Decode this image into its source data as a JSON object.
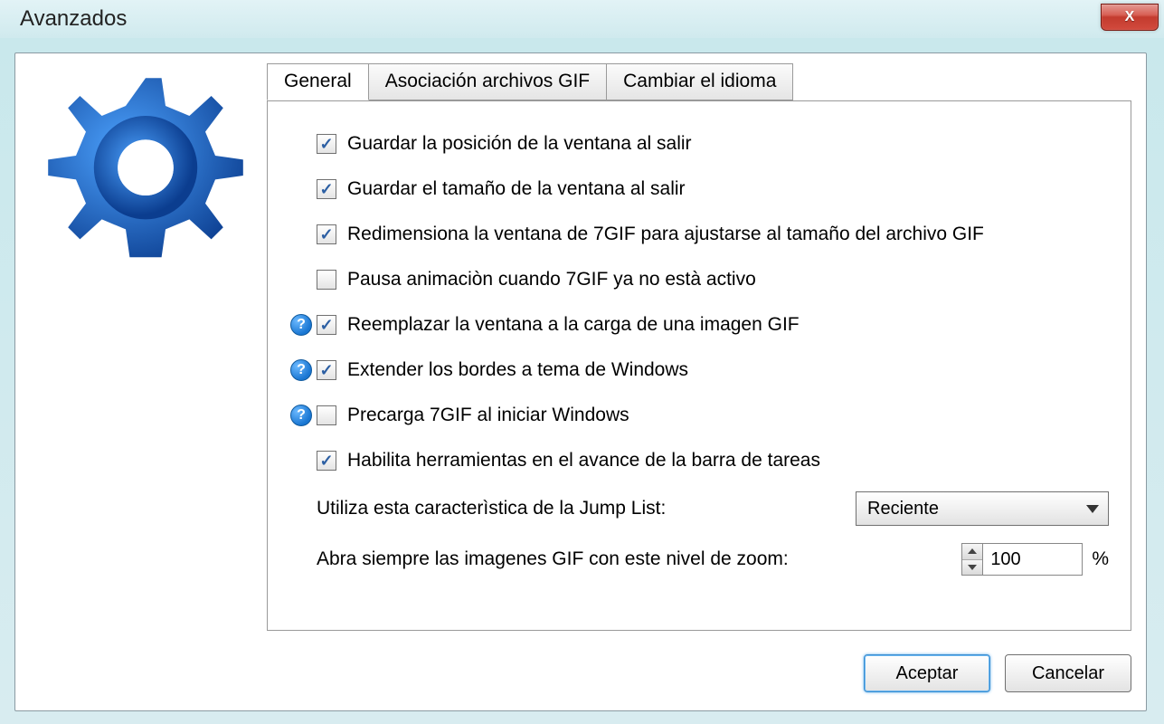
{
  "window": {
    "title": "Avanzados"
  },
  "tabs": {
    "t0": "General",
    "t1": "Asociación archivos GIF",
    "t2": "Cambiar el idioma"
  },
  "options": {
    "o0": "Guardar la posición de la ventana al salir",
    "o1": "Guardar el tamaño de la ventana al salir",
    "o2": "Redimensiona la ventana de 7GIF para ajustarse al tamaño del archivo GIF",
    "o3": "Pausa animaciòn cuando 7GIF ya no està activo",
    "o4": "Reemplazar la ventana a la carga de una imagen GIF",
    "o5": "Extender los bordes a tema de Windows",
    "o6": "Precarga 7GIF al iniciar Windows",
    "o7": "Habilita herramientas en el avance de la barra de tareas"
  },
  "jumplist": {
    "label": "Utiliza esta caracterìstica de la Jump List:",
    "value": "Reciente"
  },
  "zoom": {
    "label": "Abra siempre las imagenes GIF con este nivel de zoom:",
    "value": "100",
    "unit": "%"
  },
  "buttons": {
    "ok": "Aceptar",
    "cancel": "Cancelar"
  },
  "help_glyph": "?"
}
